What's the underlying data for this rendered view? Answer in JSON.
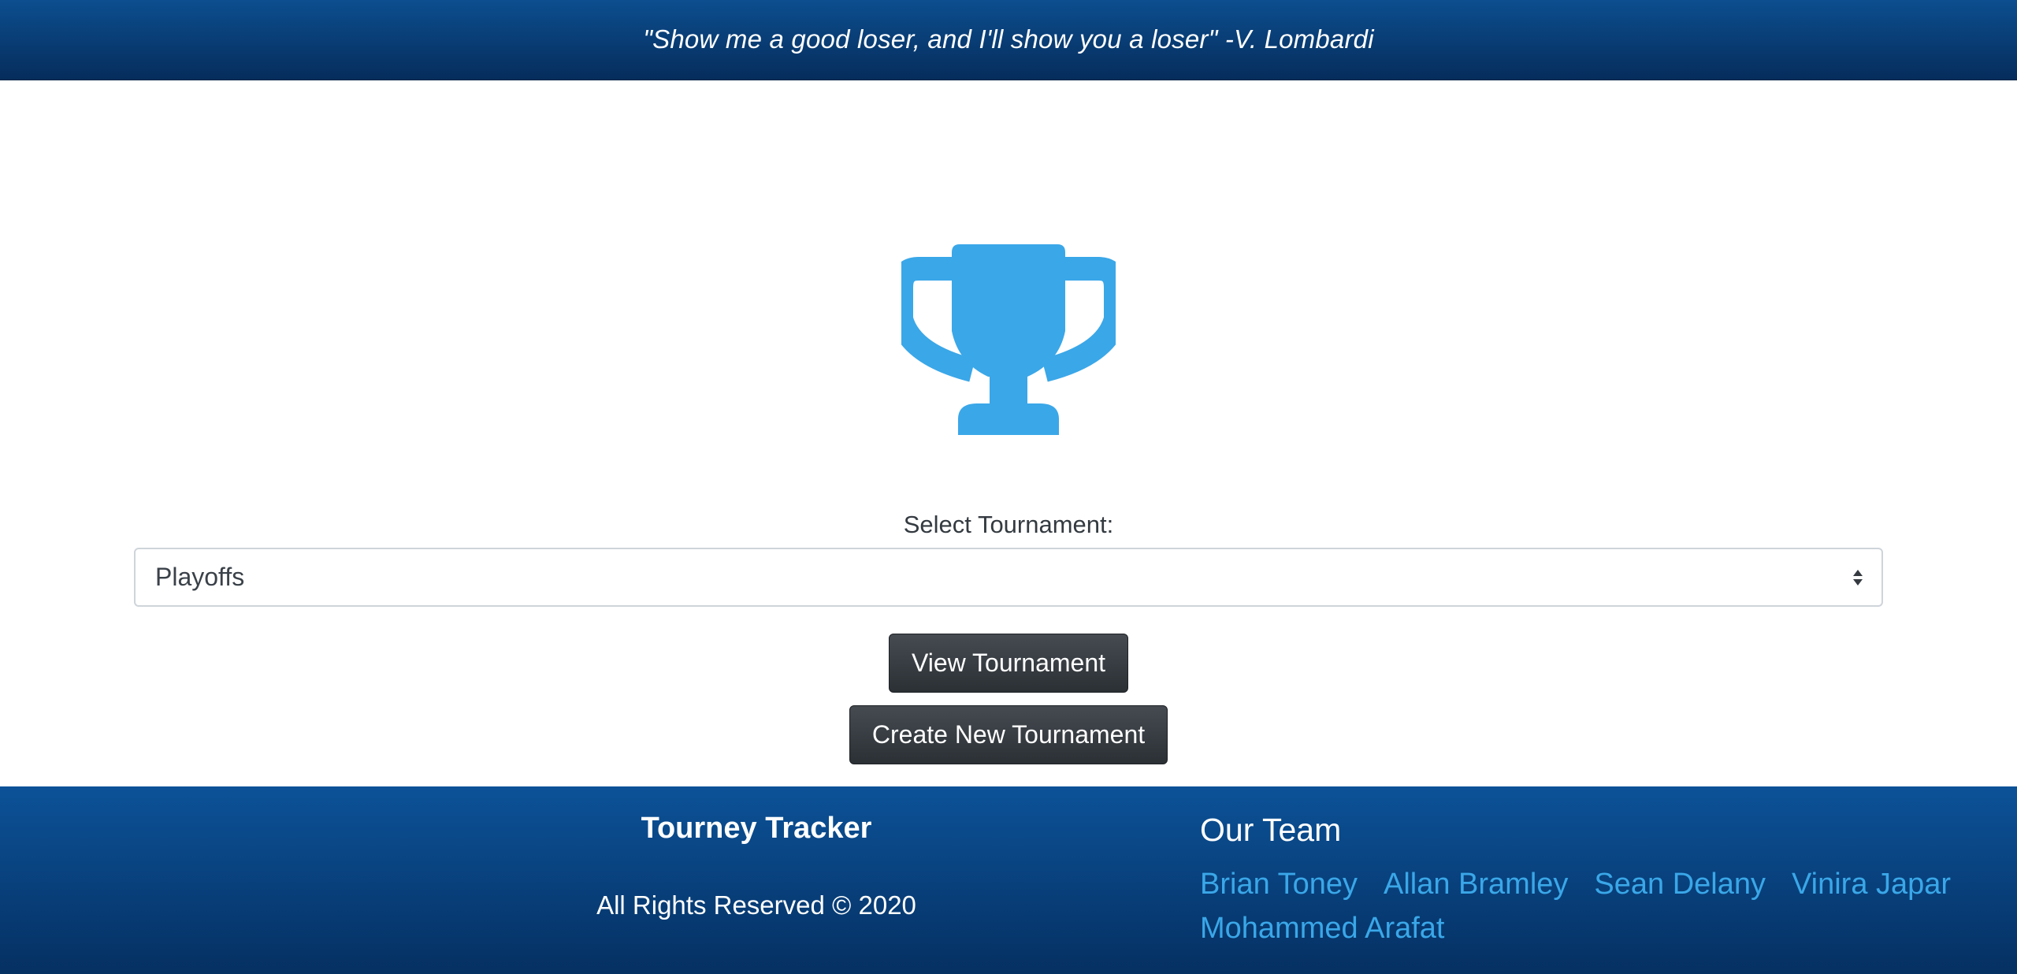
{
  "header": {
    "quote": "\"Show me a good loser, and I'll show you a loser\" -V. Lombardi"
  },
  "icons": {
    "trophy": "trophy-icon",
    "select_arrow": "sort-arrows-icon"
  },
  "form": {
    "label": "Select Tournament:",
    "selected_value": "Playoffs",
    "view_button": "View Tournament",
    "create_button": "Create New Tournament"
  },
  "footer": {
    "brand": "Tourney Tracker",
    "rights": "All Rights Reserved © 2020",
    "team_title": "Our Team",
    "team": [
      "Brian Toney",
      "Allan Bramley",
      "Sean Delany",
      "Vinira Japar",
      "Mohammed Arafat"
    ]
  },
  "colors": {
    "header_bg": "#0a3f78",
    "trophy": "#3aa7e8",
    "button_bg": "#343a40",
    "team_link": "#3aa7e8"
  }
}
